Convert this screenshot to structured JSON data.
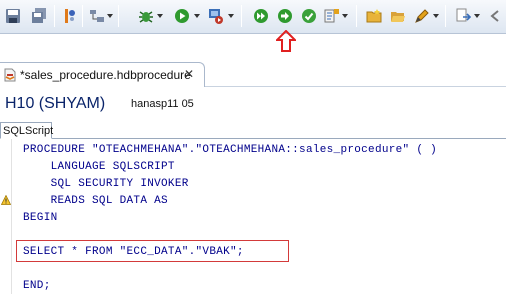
{
  "toolbar": {
    "buttons": [
      {
        "icon": "save-icon"
      },
      {
        "icon": "save-all-icon"
      },
      {
        "icon": "toggle-breakpoint-icon"
      },
      {
        "icon": "tree-hierarchy-icon"
      },
      {
        "icon": "debug-icon"
      },
      {
        "icon": "run-icon"
      },
      {
        "icon": "external-tools-icon"
      },
      {
        "icon": "activate-all-icon"
      },
      {
        "icon": "activate-icon"
      },
      {
        "icon": "check-consistency-icon"
      },
      {
        "icon": "sql-console-icon"
      },
      {
        "icon": "new-folder-icon"
      },
      {
        "icon": "open-folder-icon"
      },
      {
        "icon": "pencil-icon"
      },
      {
        "icon": "navigate-icon"
      }
    ],
    "callout_color": "#e02020"
  },
  "editor_tab": {
    "label": "*sales_procedure.hdbprocedure",
    "close_glyph": "✕",
    "icon": "procedure-file-icon"
  },
  "header": {
    "system": "H10 (SHYAM)",
    "host": "hanasp11 05"
  },
  "subtab": {
    "label": "SQLScript"
  },
  "code": {
    "lines": [
      "PROCEDURE \"OTEACHMEHANA\".\"OTEACHMEHANA::sales_procedure\" ( )",
      "    LANGUAGE SQLSCRIPT",
      "    SQL SECURITY INVOKER",
      "    READS SQL DATA AS",
      "BEGIN",
      "",
      "SELECT * FROM \"ECC_DATA\".\"VBAK\";",
      "",
      "END;"
    ],
    "text_color": "#00008b",
    "highlight_color": "#d33a3a"
  }
}
